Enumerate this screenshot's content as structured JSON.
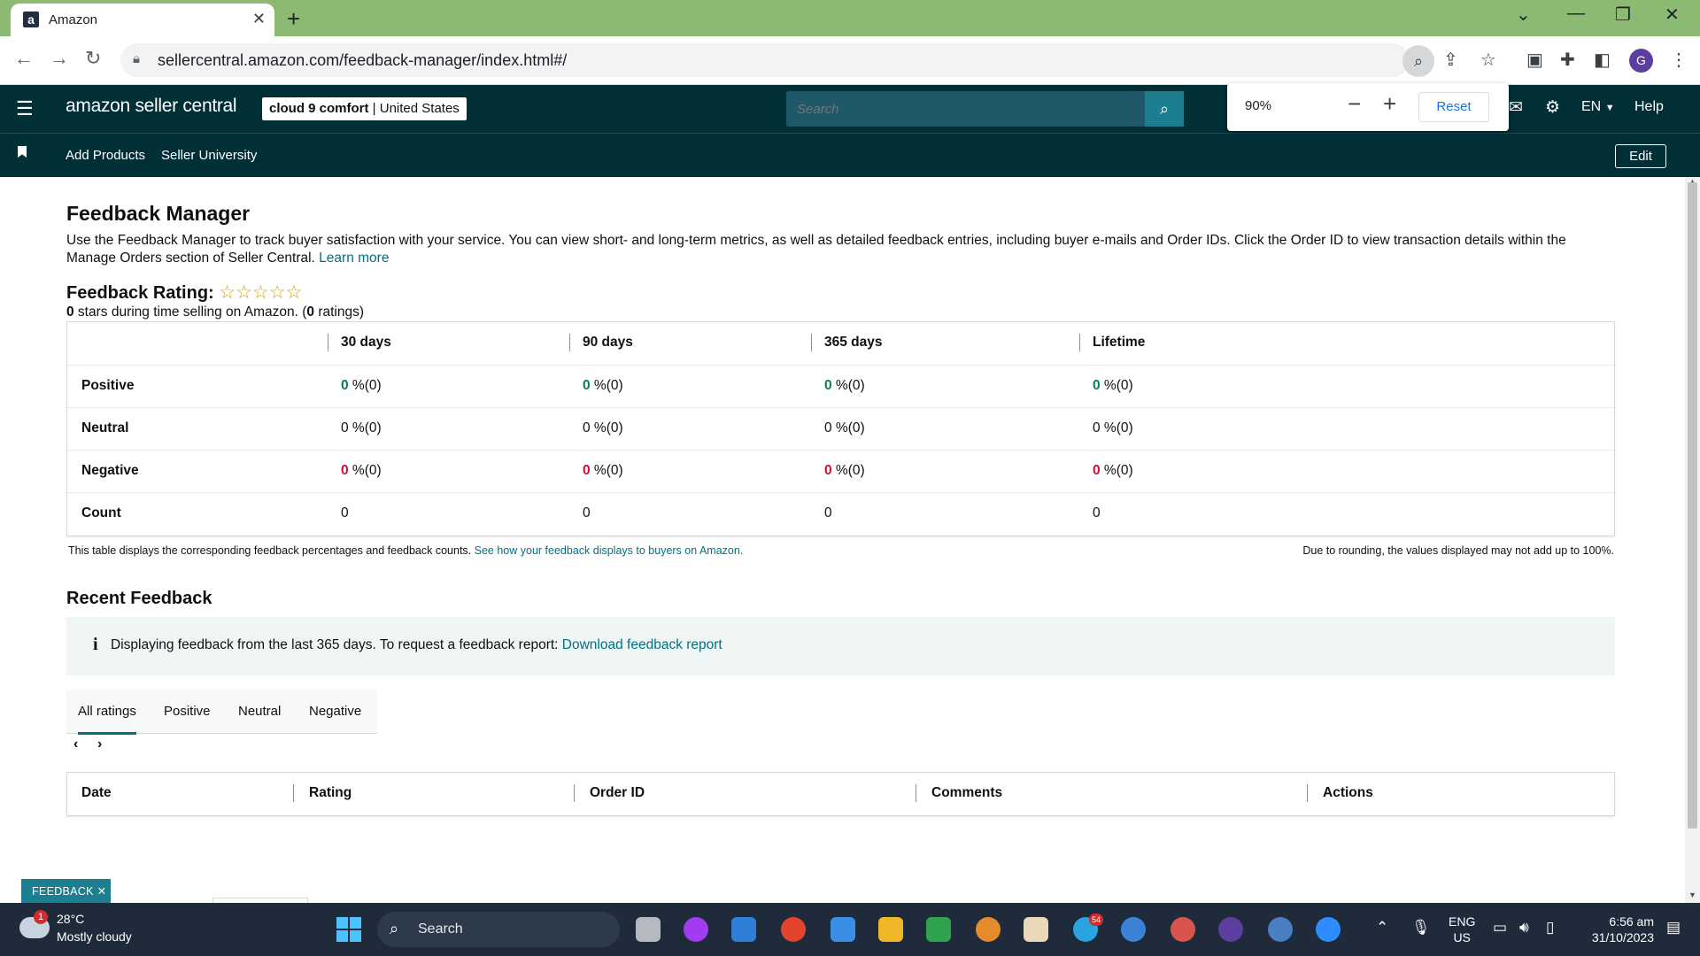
{
  "browser": {
    "tab_title": "Amazon",
    "url": "sellercentral.amazon.com/feedback-manager/index.html#/",
    "zoom_popup": {
      "level": "90%",
      "reset_label": "Reset"
    },
    "profile_initial": "G"
  },
  "header": {
    "logo_text": "amazon seller central",
    "store_name": "cloud 9 comfort",
    "store_region": "United States",
    "search_placeholder": "Search",
    "language": "EN",
    "help_label": "Help"
  },
  "nav": {
    "links": [
      "Add Products",
      "Seller University"
    ],
    "edit_label": "Edit"
  },
  "page": {
    "title": "Feedback Manager",
    "description": "Use the Feedback Manager to track buyer satisfaction with your service. You can view short- and long-term metrics, as well as detailed feedback entries, including buyer e-mails and Order IDs. Click the Order ID to view transaction details within the Manage Orders section of Seller Central.",
    "learn_more": "Learn more",
    "rating_title": "Feedback Rating:",
    "stars": "☆☆☆☆☆",
    "rating_stars_value": "0",
    "rating_sub_middle": " stars during time selling on Amazon. (",
    "rating_count": "0",
    "rating_sub_end": " ratings)"
  },
  "metrics": {
    "columns": [
      "30 days",
      "90 days",
      "365 days",
      "Lifetime"
    ],
    "rows": [
      {
        "label": "Positive",
        "values": [
          "0",
          "0",
          "0",
          "0"
        ],
        "suffix": " %(0)"
      },
      {
        "label": "Neutral",
        "values": [
          "0",
          "0",
          "0",
          "0"
        ],
        "suffix": " %(0)"
      },
      {
        "label": "Negative",
        "values": [
          "0",
          "0",
          "0",
          "0"
        ],
        "suffix": " %(0)"
      },
      {
        "label": "Count",
        "values": [
          "0",
          "0",
          "0",
          "0"
        ]
      }
    ],
    "footnote": "This table displays the corresponding feedback percentages and feedback counts.",
    "footnote_link": "See how your feedback displays to buyers on Amazon.",
    "rounding_note": "Due to rounding, the values displayed may not add up to 100%."
  },
  "recent": {
    "title": "Recent Feedback",
    "info_text": "Displaying feedback from the last 365 days. To request a feedback report:",
    "info_link": "Download feedback report",
    "tabs": [
      "All ratings",
      "Positive",
      "Neutral",
      "Negative"
    ],
    "active_tab": "All ratings",
    "table_headers": [
      "Date",
      "Rating",
      "Order ID",
      "Comments",
      "Actions"
    ]
  },
  "feedback_button": "FEEDBACK",
  "taskbar": {
    "weather_badge": "1",
    "temperature": "28°C",
    "weather": "Mostly cloudy",
    "search_label": "Search",
    "telegram_badge": "54",
    "language_line1": "ENG",
    "language_line2": "US",
    "time": "6:56 am",
    "date": "31/10/2023"
  },
  "colors": {
    "tabbar": "#8dba73",
    "seller_header": "#002f36",
    "accent_link": "#007185",
    "positive": "#067d62",
    "negative": "#cc0c39",
    "taskbar": "#1f2b3b"
  }
}
